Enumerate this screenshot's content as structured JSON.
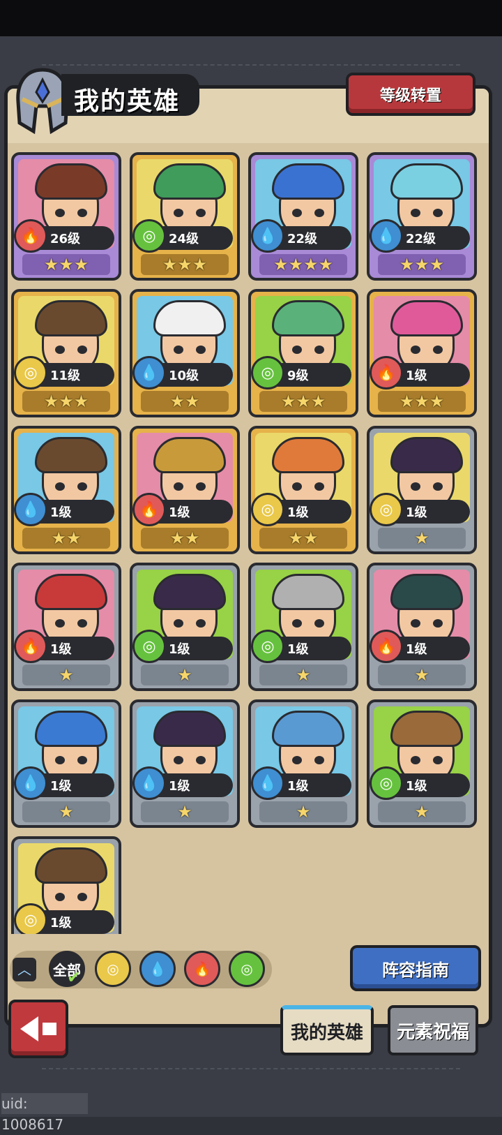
{
  "header": {
    "title": "我的英雄",
    "level_transfer_button": "等级转置"
  },
  "heroes": [
    {
      "level": "26级",
      "stars": "★★★",
      "element": "fire",
      "rarity": "purple",
      "bg": "pink"
    },
    {
      "level": "24级",
      "stars": "★★★",
      "element": "wood",
      "rarity": "gold",
      "bg": "yellow"
    },
    {
      "level": "22级",
      "stars": "★★★★",
      "element": "water",
      "rarity": "purple",
      "bg": "blue"
    },
    {
      "level": "22级",
      "stars": "★★★",
      "element": "water",
      "rarity": "purple",
      "bg": "blue"
    },
    {
      "level": "11级",
      "stars": "★★★",
      "element": "earth",
      "rarity": "gold",
      "bg": "yellow"
    },
    {
      "level": "10级",
      "stars": "★★",
      "element": "water",
      "rarity": "gold",
      "bg": "blue"
    },
    {
      "level": "9级",
      "stars": "★★★",
      "element": "wood",
      "rarity": "gold",
      "bg": "green"
    },
    {
      "level": "1级",
      "stars": "★★★",
      "element": "fire",
      "rarity": "gold",
      "bg": "pink"
    },
    {
      "level": "1级",
      "stars": "★★",
      "element": "water",
      "rarity": "gold",
      "bg": "blue"
    },
    {
      "level": "1级",
      "stars": "★★",
      "element": "fire",
      "rarity": "gold",
      "bg": "pink"
    },
    {
      "level": "1级",
      "stars": "★★",
      "element": "earth",
      "rarity": "gold",
      "bg": "yellow"
    },
    {
      "level": "1级",
      "stars": "★",
      "element": "earth",
      "rarity": "grey",
      "bg": "yellow"
    },
    {
      "level": "1级",
      "stars": "★",
      "element": "fire",
      "rarity": "grey",
      "bg": "pink"
    },
    {
      "level": "1级",
      "stars": "★",
      "element": "wood",
      "rarity": "grey",
      "bg": "green"
    },
    {
      "level": "1级",
      "stars": "★",
      "element": "wood",
      "rarity": "grey",
      "bg": "green"
    },
    {
      "level": "1级",
      "stars": "★",
      "element": "fire",
      "rarity": "grey",
      "bg": "pink"
    },
    {
      "level": "1级",
      "stars": "★",
      "element": "water",
      "rarity": "grey",
      "bg": "blue"
    },
    {
      "level": "1级",
      "stars": "★",
      "element": "water",
      "rarity": "grey",
      "bg": "blue"
    },
    {
      "level": "1级",
      "stars": "★",
      "element": "water",
      "rarity": "grey",
      "bg": "blue"
    },
    {
      "level": "1级",
      "stars": "★",
      "element": "wood",
      "rarity": "grey",
      "bg": "green"
    },
    {
      "level": "1级",
      "stars": "★",
      "element": "earth",
      "rarity": "grey",
      "bg": "yellow"
    }
  ],
  "filters": {
    "all_label": "全部",
    "elements": [
      "earth",
      "water",
      "fire",
      "wood"
    ]
  },
  "lineup_guide_button": "阵容指南",
  "tabs": {
    "my_heroes": "我的英雄",
    "element_blessing": "元素祝福"
  },
  "uid": "uid: 1008617"
}
